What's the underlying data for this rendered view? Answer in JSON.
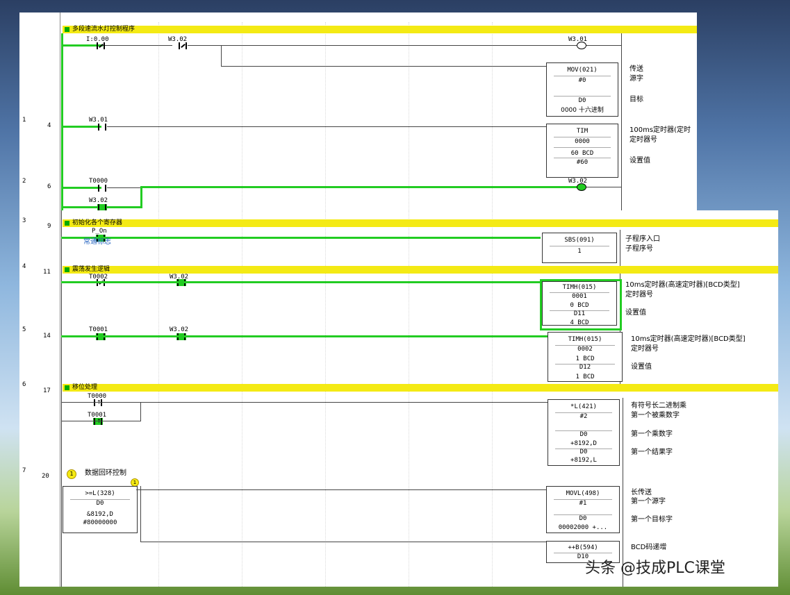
{
  "sections": {
    "s1": "多段速流水灯控制程序",
    "s2": "初始化各个寄存器",
    "s3": "震荡发生逻辑",
    "s4": "移位处理"
  },
  "rungs": [
    {
      "idx": "1",
      "step": "4"
    },
    {
      "idx": "2",
      "step": "6"
    },
    {
      "idx": "3",
      "step": "9"
    },
    {
      "idx": "4",
      "step": "11"
    },
    {
      "idx": "5",
      "step": "14"
    },
    {
      "idx": "6",
      "step": "17"
    },
    {
      "idx": "7",
      "step": "20"
    }
  ],
  "r0": {
    "c1": "I:0.00",
    "c2": "W3.02",
    "coil": "W3.01",
    "mov": {
      "name": "MOV(021)",
      "src": "#0",
      "dst": "D0",
      "fmt": "0000 十六进制"
    },
    "cm": {
      "a": "传送",
      "b": "源字",
      "c": "目标"
    }
  },
  "r1": {
    "c1": "W3.01",
    "tim": {
      "name": "TIM",
      "num": "0000",
      "bcd": "60 BCD",
      "val": "#60"
    },
    "cm": {
      "a": "100ms定时器(定时",
      "b": "定时器号",
      "c": "设置值"
    }
  },
  "r2": {
    "c1": "T0000",
    "c2": "W3.02",
    "coil": "W3.02"
  },
  "r3": {
    "c1": "P_On",
    "note": "常通标志",
    "sbs": {
      "name": "SBS(091)",
      "num": "1"
    },
    "cm": {
      "a": "子程序入口",
      "b": "子程序号"
    }
  },
  "r4": {
    "c1": "T0002",
    "c2": "W3.02",
    "timh": {
      "name": "TIMH(015)",
      "num": "0001",
      "bcd": "0 BCD",
      "val": "D11",
      "bcd2": "4 BCD"
    },
    "cm": {
      "a": "10ms定时器(高速定时器)[BCD类型]",
      "b": "定时器号",
      "c": "设置值"
    }
  },
  "r5": {
    "c1": "T0001",
    "c2": "W3.02",
    "timh": {
      "name": "TIMH(015)",
      "num": "0002",
      "bcd": "1 BCD",
      "val": "D12",
      "bcd2": "1 BCD"
    },
    "cm": {
      "a": "10ms定时器(高速定时器)[BCD类型]",
      "b": "定时器号",
      "c": "设置值"
    }
  },
  "r6": {
    "c1": "T0000",
    "c2": "T0001",
    "mul": {
      "name": "*L(421)",
      "a": "#2",
      "b": "D0",
      "b2": "+8192,D",
      "c": "D0",
      "c2": "+8192,L"
    },
    "cm": {
      "a": "有符号长二进制乘",
      "b": "第一个被乘数字",
      "c": "第一个乘数字",
      "d": "第一个结果字"
    }
  },
  "r7": {
    "badge": "1",
    "title": "数据回环控制",
    "cmp": {
      "name": ">=L(328)",
      "a": "D0",
      "b": "&8192,D",
      "c": "#80000000"
    },
    "movl": {
      "name": "MOVL(498)",
      "a": "#1",
      "b": "D0",
      "c": "00002000 +..."
    },
    "inc": {
      "name": "++B(594)",
      "a": "D10"
    },
    "cm": {
      "a": "长传送",
      "b": "第一个源字",
      "c": "第一个目标字",
      "d": "BCD码递增"
    }
  },
  "watermark": "头条 @技成PLC课堂",
  "colors": {
    "rail": "#22cc22",
    "section_bar": "#f4ea14",
    "comment_blue": "#1f5fbf"
  }
}
